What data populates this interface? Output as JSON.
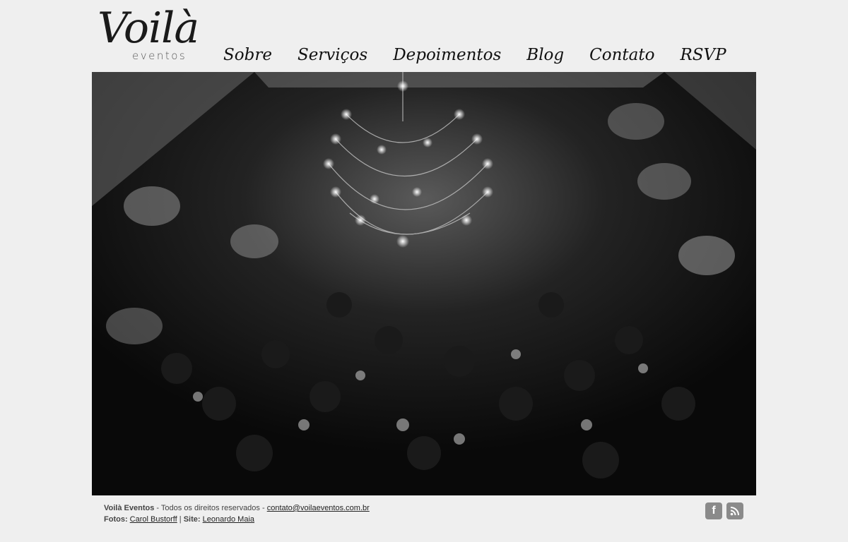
{
  "logo": {
    "main": "Voilà",
    "sub": "eventos"
  },
  "nav": [
    {
      "label": "Sobre"
    },
    {
      "label": "Serviços"
    },
    {
      "label": "Depoimentos"
    },
    {
      "label": "Blog"
    },
    {
      "label": "Contato"
    },
    {
      "label": "RSVP"
    }
  ],
  "hero": {
    "alt": "black and white photo of a party dance floor under a chandelier"
  },
  "footer": {
    "brand": "Voilà Eventos",
    "rights": " - Todos os direitos reservados - ",
    "email": "contato@voilaeventos.com.br",
    "photos_label": "Fotos:",
    "photos_credit": "Carol Bustorff",
    "separator": " | ",
    "site_label": "Site:",
    "site_credit": "Leonardo Maia"
  },
  "social": {
    "facebook_icon": "facebook-icon",
    "rss_icon": "rss-icon"
  }
}
